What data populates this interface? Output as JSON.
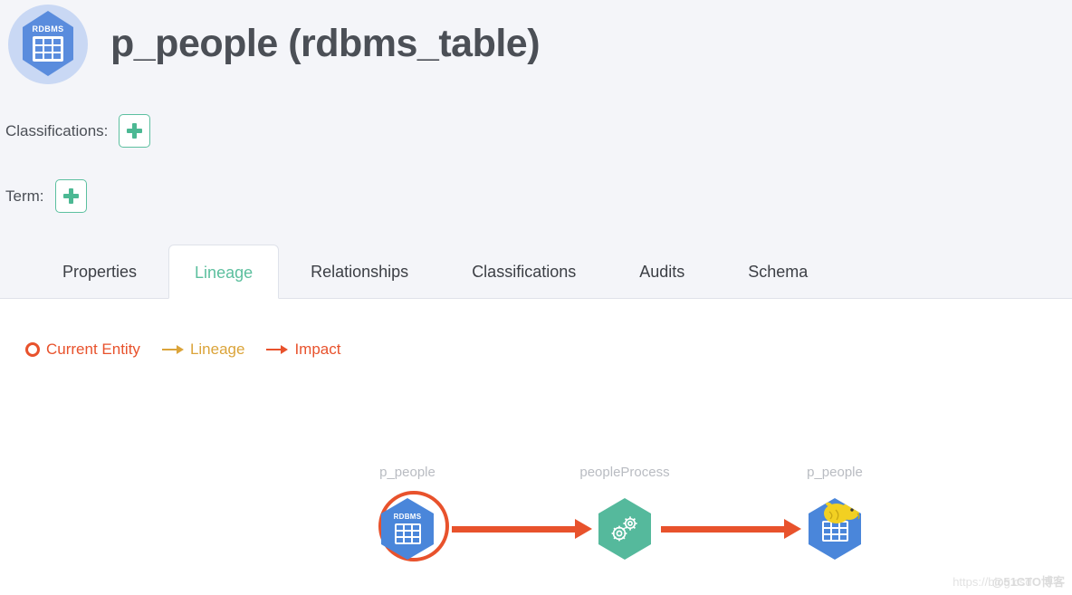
{
  "theme": {
    "top_background": "#f4f5f9",
    "content_background": "#ffffff",
    "accent_green": "#5cbf9e",
    "accent_orange": "#e8522c",
    "accent_gold": "#dba43a",
    "node_blue": "#4a86da",
    "node_green": "#55b99c",
    "label_gray": "#b9bcc2"
  },
  "header": {
    "title": "p_people (rdbms_table)",
    "logo_icon": "rdbms-table-icon",
    "logo_text": "RDBMS"
  },
  "meta": {
    "classifications": {
      "label": "Classifications:",
      "add_icon": "plus-icon",
      "add_title": "Add Classification"
    },
    "term": {
      "label": "Term:",
      "add_icon": "plus-icon",
      "add_title": "Add Term"
    }
  },
  "tabs": [
    {
      "label": "Properties",
      "active": false
    },
    {
      "label": "Lineage",
      "active": true
    },
    {
      "label": "Relationships",
      "active": false
    },
    {
      "label": "Classifications",
      "active": false
    },
    {
      "label": "Audits",
      "active": false
    },
    {
      "label": "Schema",
      "active": false
    }
  ],
  "legend": [
    {
      "label": "Current Entity",
      "icon": "circle-outline-icon",
      "color": "#e8522c"
    },
    {
      "label": "Lineage",
      "icon": "arrow-right-icon",
      "color": "#dba43a"
    },
    {
      "label": "Impact",
      "icon": "arrow-right-icon",
      "color": "#e8522c"
    }
  ],
  "lineage": {
    "nodes": [
      {
        "label": "p_people",
        "type": "rdbms_table",
        "shape": "hexagon",
        "color": "#4a86da",
        "icon": "rdbms-table-icon",
        "badge_text": "RDBMS",
        "highlighted": true
      },
      {
        "label": "peopleProcess",
        "type": "process",
        "shape": "hexagon",
        "color": "#55b99c",
        "icon": "gears-icon",
        "badge_text": "",
        "highlighted": false
      },
      {
        "label": "p_people",
        "type": "hive_table",
        "shape": "hexagon",
        "color": "#4a86da",
        "icon": "hive-table-icon",
        "badge_text": "",
        "highlighted": false
      }
    ],
    "edges": [
      {
        "from": "p_people",
        "to": "peopleProcess",
        "color": "#e8522c"
      },
      {
        "from": "peopleProcess",
        "to": "p_people",
        "color": "#e8522c"
      }
    ]
  },
  "watermark": {
    "url_text": "https://blog.csd",
    "brand_text": "@51CTO博客"
  }
}
